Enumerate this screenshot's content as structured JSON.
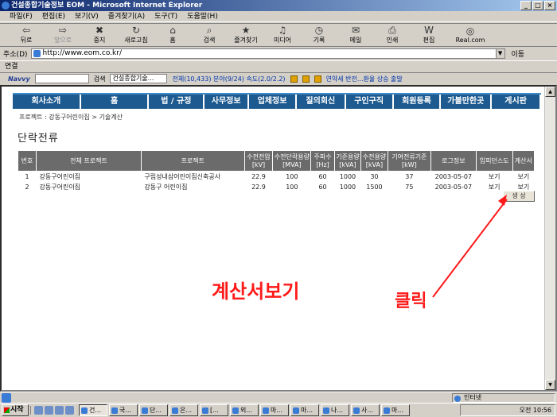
{
  "window": {
    "title": "건설종합기술정보 EOM - Microsoft Internet Explorer"
  },
  "menu": [
    "파일(F)",
    "편집(E)",
    "보기(V)",
    "즐겨찾기(A)",
    "도구(T)",
    "도움말(H)"
  ],
  "toolbar": [
    {
      "label": "뒤로",
      "icon": "back-arrow-icon",
      "glyph": "⇦"
    },
    {
      "label": "앞으로",
      "icon": "forward-arrow-icon",
      "glyph": "⇨",
      "disabled": true
    },
    {
      "label": "중지",
      "icon": "stop-icon",
      "glyph": "✖"
    },
    {
      "label": "새로고침",
      "icon": "refresh-icon",
      "glyph": "↻"
    },
    {
      "label": "홈",
      "icon": "home-icon",
      "glyph": "⌂"
    },
    {
      "label": "검색",
      "icon": "search-icon",
      "glyph": "⌕"
    },
    {
      "label": "즐겨찾기",
      "icon": "favorites-icon",
      "glyph": "★"
    },
    {
      "label": "미디어",
      "icon": "media-icon",
      "glyph": "♫"
    },
    {
      "label": "기록",
      "icon": "history-icon",
      "glyph": "◷"
    },
    {
      "label": "메일",
      "icon": "mail-icon",
      "glyph": "✉"
    },
    {
      "label": "인쇄",
      "icon": "print-icon",
      "glyph": "⎙"
    },
    {
      "label": "편집",
      "icon": "edit-icon",
      "glyph": "W"
    },
    {
      "label": "Real.com",
      "icon": "realcom-icon",
      "glyph": "◎"
    }
  ],
  "address": {
    "label": "주소(D)",
    "url": "http://www.eom.co.kr/",
    "go": "이동"
  },
  "links": {
    "label": "연결"
  },
  "navybar": {
    "logo": "Navvy",
    "search_label": "검색",
    "result": "건설종합기술...",
    "stats": "전체(10,433) 분야(9/24) 속도(2.0/2.2)",
    "news": "연약세 반전...환율 상승 출발"
  },
  "nav": [
    "회사소개",
    "홈",
    "법 / 규정",
    "사무정보",
    "업체정보",
    "질의회신",
    "구인구직",
    "회원등록",
    "가볼만한곳",
    "게시판"
  ],
  "breadcrumb": "프로젝트 : 강동구어린이집 > 기술계산",
  "page_title": "단락전류",
  "table": {
    "headers": [
      "번호",
      "전체 프로젝트",
      "프로젝트",
      "수전전압\n[kV]",
      "수전단락용량\n[MVA]",
      "주파수\n[Hz]",
      "기준용량\n[kVA]",
      "수전용량\n[kVA]",
      "기여전류기준\n[kW]",
      "로그정보",
      "임피던스도",
      "계산서"
    ],
    "rows": [
      [
        "1",
        "강동구어린이집",
        "구립성내삼어린이집신축공사",
        "22.9",
        "100",
        "60",
        "1000",
        "30",
        "37",
        "2003-05-07",
        "보기",
        "보기"
      ],
      [
        "2",
        "강동구어린이집",
        "강동구 어린이집",
        "22.9",
        "100",
        "60",
        "1000",
        "1500",
        "75",
        "2003-05-07",
        "보기",
        "보기"
      ]
    ]
  },
  "generate_button": "생 성",
  "annotations": {
    "view_report": "계산서보기",
    "click": "클릭",
    "color": "#ff1a1a"
  },
  "status": {
    "zone": "인터넷"
  },
  "taskbar": {
    "start": "시작",
    "tasks": [
      "건...",
      "국...",
      "단...",
      "은...",
      "[...",
      "외...",
      "마...",
      "마...",
      "나...",
      "사...",
      "마..."
    ],
    "clock": "오전 10:56"
  }
}
